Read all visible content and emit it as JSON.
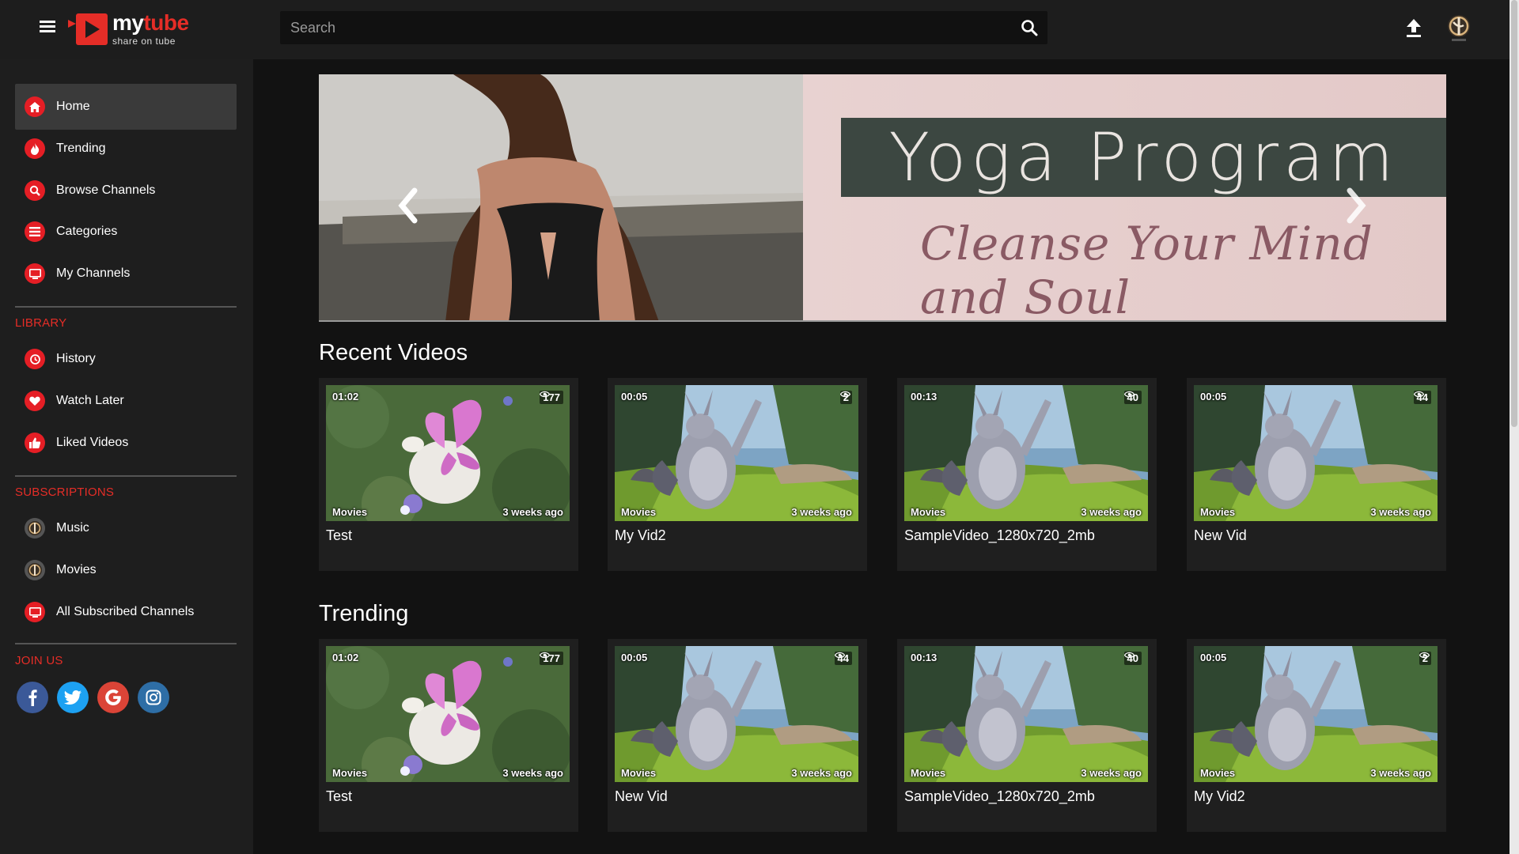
{
  "header": {
    "logo_my": "my",
    "logo_tube": "tube",
    "logo_tagline": "share on tube",
    "search_placeholder": "Search"
  },
  "sidebar": {
    "main_items": [
      {
        "label": "Home",
        "icon": "home-icon",
        "active": true
      },
      {
        "label": "Trending",
        "icon": "fire-icon"
      },
      {
        "label": "Browse Channels",
        "icon": "search-icon"
      },
      {
        "label": "Categories",
        "icon": "list-icon"
      },
      {
        "label": "My Channels",
        "icon": "monitor-icon"
      }
    ],
    "library_title": "LIBRARY",
    "library_items": [
      {
        "label": "History",
        "icon": "history-icon"
      },
      {
        "label": "Watch Later",
        "icon": "heart-icon"
      },
      {
        "label": "Liked Videos",
        "icon": "thumbs-up-icon"
      }
    ],
    "subscriptions_title": "SUBSCRIPTIONS",
    "subscription_items": [
      {
        "label": "Music",
        "icon": "channel-avatar-icon"
      },
      {
        "label": "Movies",
        "icon": "channel-avatar-icon"
      },
      {
        "label": "All Subscribed Channels",
        "icon": "monitor-icon"
      }
    ],
    "join_title": "JOIN US",
    "social": [
      {
        "name": "facebook-icon",
        "color": "#3b5998"
      },
      {
        "name": "twitter-icon",
        "color": "#1da1f2"
      },
      {
        "name": "google-icon",
        "color": "#db4437"
      },
      {
        "name": "instagram-icon",
        "color": "#2e6ea6"
      }
    ]
  },
  "hero": {
    "title": "Yoga Program",
    "subtitle": "Cleanse Your Mind and Soul"
  },
  "sections": [
    {
      "title": "Recent Videos",
      "videos": [
        {
          "duration": "01:02",
          "views": "177",
          "category": "Movies",
          "age": "3 weeks ago",
          "title": "Test",
          "thumb": "butterfly"
        },
        {
          "duration": "00:05",
          "views": "2",
          "category": "Movies",
          "age": "3 weeks ago",
          "title": "My Vid2",
          "thumb": "bunny"
        },
        {
          "duration": "00:13",
          "views": "40",
          "category": "Movies",
          "age": "3 weeks ago",
          "title": "SampleVideo_1280x720_2mb",
          "thumb": "bunny"
        },
        {
          "duration": "00:05",
          "views": "44",
          "category": "Movies",
          "age": "3 weeks ago",
          "title": "New Vid",
          "thumb": "bunny"
        }
      ]
    },
    {
      "title": "Trending",
      "videos": [
        {
          "duration": "01:02",
          "views": "177",
          "category": "Movies",
          "age": "3 weeks ago",
          "title": "Test",
          "thumb": "butterfly"
        },
        {
          "duration": "00:05",
          "views": "44",
          "category": "Movies",
          "age": "3 weeks ago",
          "title": "New Vid",
          "thumb": "bunny"
        },
        {
          "duration": "00:13",
          "views": "40",
          "category": "Movies",
          "age": "3 weeks ago",
          "title": "SampleVideo_1280x720_2mb",
          "thumb": "bunny"
        },
        {
          "duration": "00:05",
          "views": "2",
          "category": "Movies",
          "age": "3 weeks ago",
          "title": "My Vid2",
          "thumb": "bunny"
        }
      ]
    }
  ],
  "colors": {
    "accent": "#e52d27",
    "header_bg": "#1d1d1d",
    "sidebar_bg": "#1e1e1e",
    "card_bg": "#1f1f1f"
  }
}
